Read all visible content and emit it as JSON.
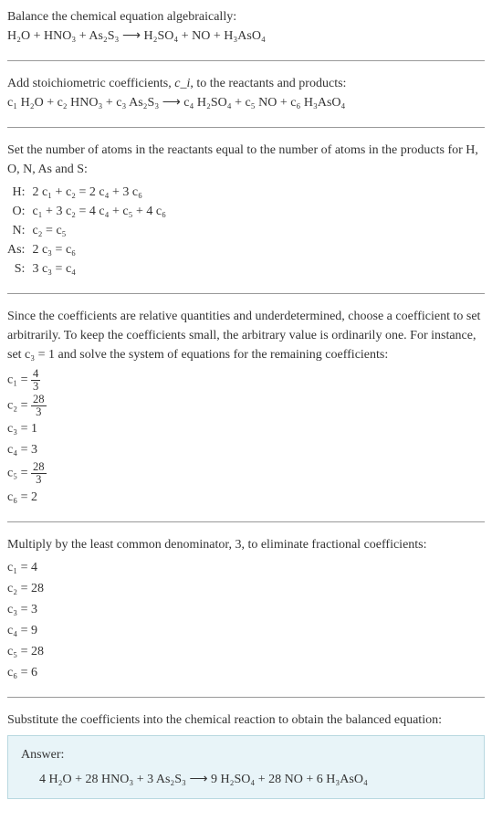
{
  "s1": {
    "intro": "Balance the chemical equation algebraically:",
    "eq": "H₂O + HNO₃ + As₂S₃ ⟶ H₂SO₄ + NO + H₃AsO₄"
  },
  "s2": {
    "intro_a": "Add stoichiometric coefficients, ",
    "intro_ci": "c_i",
    "intro_b": ", to the reactants and products:",
    "eq": "c₁ H₂O + c₂ HNO₃ + c₃ As₂S₃ ⟶ c₄ H₂SO₄ + c₅ NO + c₆ H₃AsO₄"
  },
  "s3": {
    "intro": "Set the number of atoms in the reactants equal to the number of atoms in the products for H, O, N, As and S:",
    "rows": [
      {
        "label": "H:",
        "eq": "2 c₁ + c₂ = 2 c₄ + 3 c₆"
      },
      {
        "label": "O:",
        "eq": "c₁ + 3 c₂ = 4 c₄ + c₅ + 4 c₆"
      },
      {
        "label": "N:",
        "eq": "c₂ = c₅"
      },
      {
        "label": "As:",
        "eq": "2 c₃ = c₆"
      },
      {
        "label": "S:",
        "eq": "3 c₃ = c₄"
      }
    ]
  },
  "s4": {
    "intro": "Since the coefficients are relative quantities and underdetermined, choose a coefficient to set arbitrarily. To keep the coefficients small, the arbitrary value is ordinarily one. For instance, set c₃ = 1 and solve the system of equations for the remaining coefficients:",
    "c1_lhs": "c₁ = ",
    "c1_num": "4",
    "c1_den": "3",
    "c2_lhs": "c₂ = ",
    "c2_num": "28",
    "c2_den": "3",
    "c3": "c₃ = 1",
    "c4": "c₄ = 3",
    "c5_lhs": "c₅ = ",
    "c5_num": "28",
    "c5_den": "3",
    "c6": "c₆ = 2"
  },
  "s5": {
    "intro": "Multiply by the least common denominator, 3, to eliminate fractional coefficients:",
    "lines": [
      "c₁ = 4",
      "c₂ = 28",
      "c₃ = 3",
      "c₄ = 9",
      "c₅ = 28",
      "c₆ = 6"
    ]
  },
  "s6": {
    "intro": "Substitute the coefficients into the chemical reaction to obtain the balanced equation:",
    "answer_label": "Answer:",
    "answer_eq": "4 H₂O + 28 HNO₃ + 3 As₂S₃ ⟶ 9 H₂SO₄ + 28 NO + 6 H₃AsO₄"
  }
}
